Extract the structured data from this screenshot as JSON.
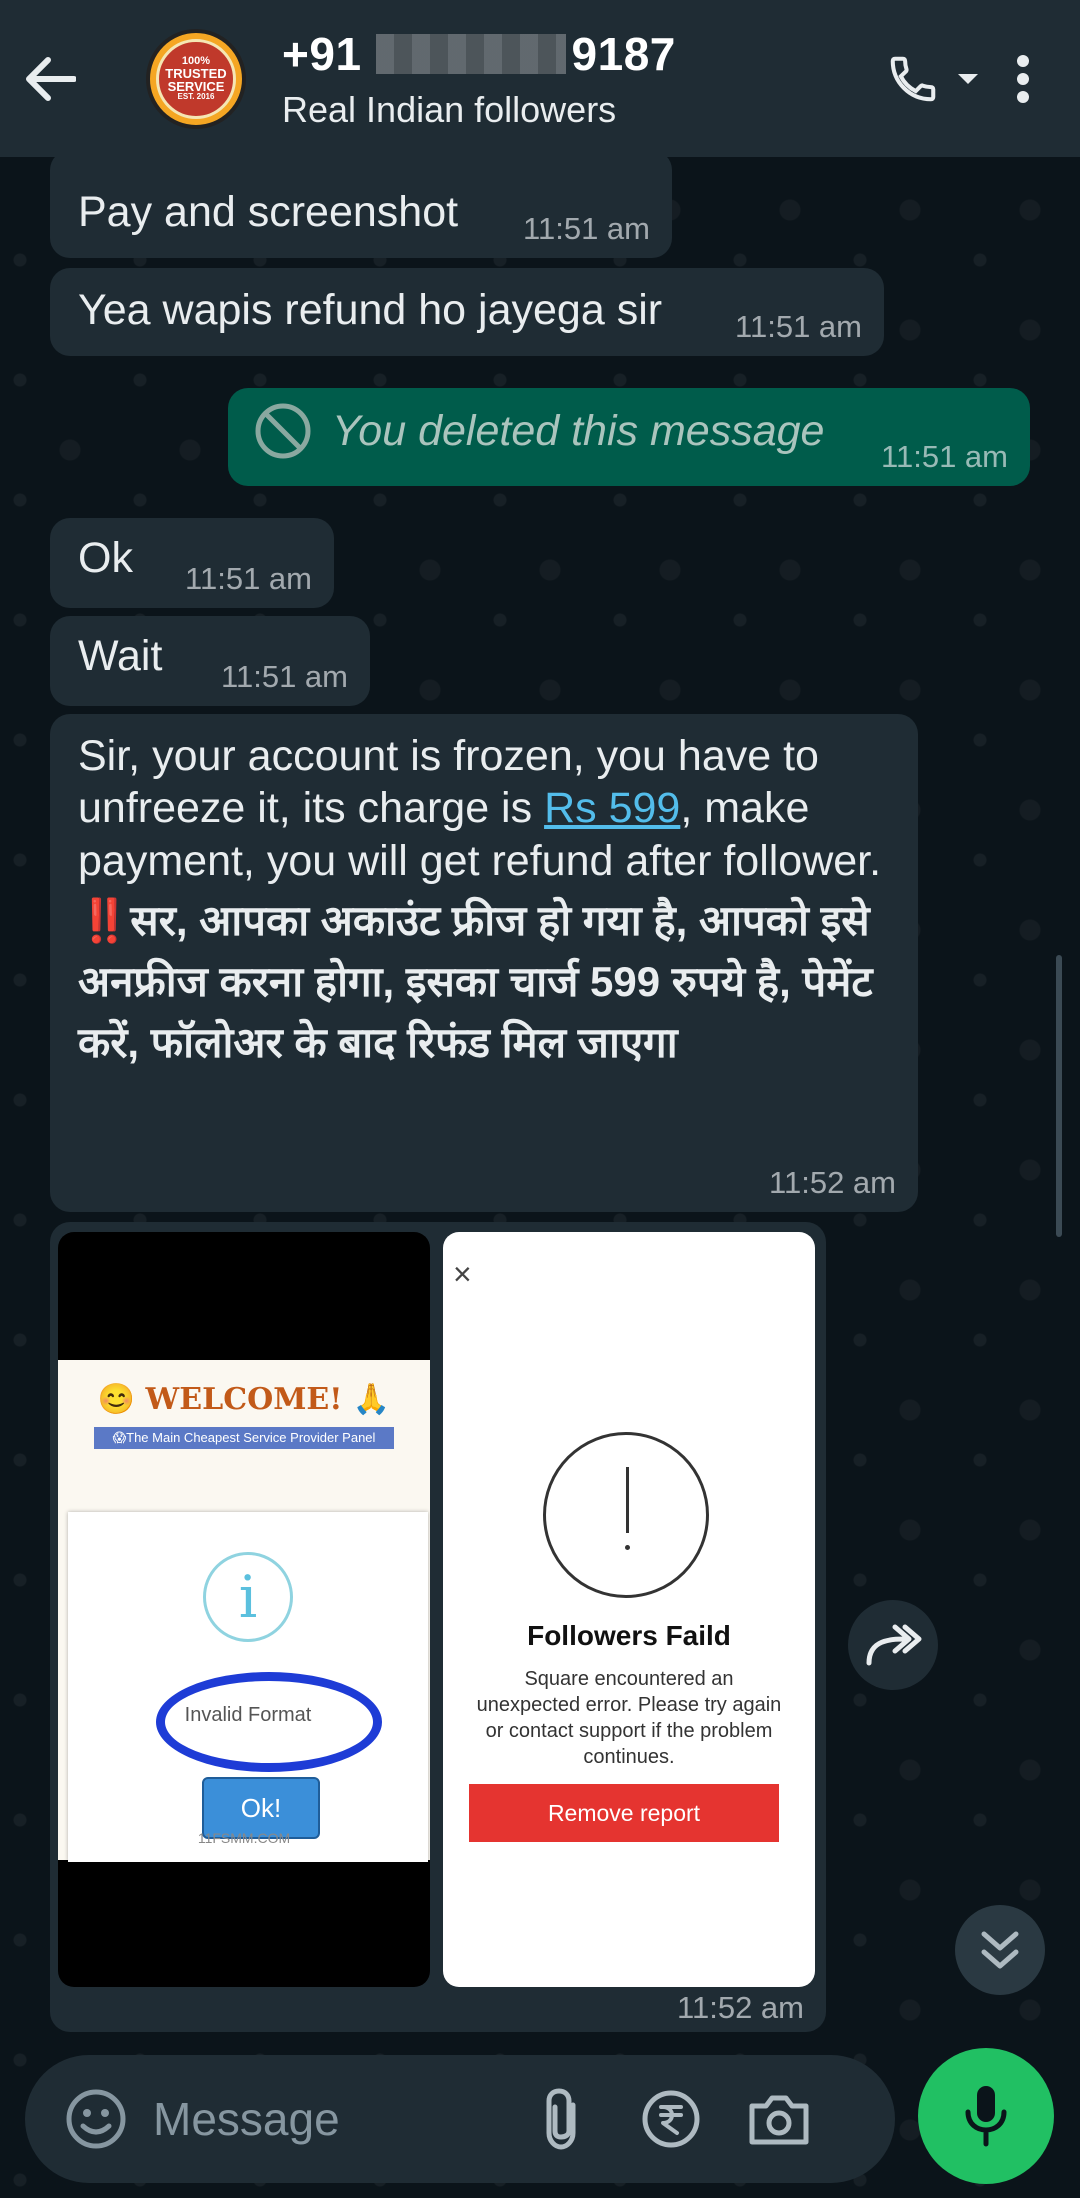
{
  "header": {
    "number_prefix": "+91",
    "number_suffix": "9187",
    "subtitle": "Real Indian followers",
    "avatar_lines": [
      "100%",
      "TRUSTED",
      "SERVICE",
      "EST. 2016"
    ]
  },
  "messages": [
    {
      "text": "Pay and screenshot",
      "time": "11:51 am",
      "direction": "in"
    },
    {
      "text": "Yea wapis refund ho jayega sir",
      "time": "11:51 am",
      "direction": "in"
    },
    {
      "text": "You deleted this message",
      "time": "11:51 am",
      "direction": "out"
    },
    {
      "text": "Ok",
      "time": "11:51 am",
      "direction": "in"
    },
    {
      "text": "Wait",
      "time": "11:51 am",
      "direction": "in"
    },
    {
      "text_before_link": "Sir, your account is frozen, you have to unfreeze it, its charge is ",
      "link": "Rs 599",
      "text_after_link": ", make payment, you will get refund after follower.",
      "bang": "‼️",
      "hindi": "सर, आपका अकाउंट फ्रीज हो गया है, आपको इसे अनफ्रीज करना होगा, इसका चार्ज 599 रुपये है, पेमेंट करें, फॉलोअर के बाद रिफंड मिल जाएगा",
      "time": "11:52 am",
      "direction": "in"
    }
  ],
  "images": {
    "time": "11:52 am",
    "left": {
      "welcome": "😊 WELCOME! 🙏",
      "panel_text": "😱The Main Cheapest Service Provider Panel",
      "dialog_icon": "i",
      "dialog_text": "Invalid Format",
      "ok_label": "Ok!",
      "footer": "11FSMM.COM"
    },
    "right": {
      "close": "×",
      "title": "Followers Faild",
      "body": "Square encountered an unexpected error. Please try again or contact support if the problem continues.",
      "button": "Remove report"
    }
  },
  "input": {
    "placeholder": "Message"
  },
  "colors": {
    "header_bg": "#1f2c34",
    "incoming_bubble": "#1f2c34",
    "outgoing_bubble": "#005c4b",
    "mic_button": "#21c063",
    "link": "#53bdeb"
  },
  "icons": [
    "back-arrow-icon",
    "phone-icon",
    "dropdown-icon",
    "more-vert-icon",
    "deleted-icon",
    "forward-icon",
    "double-chevron-down-icon",
    "emoji-icon",
    "attach-icon",
    "rupee-icon",
    "camera-icon",
    "mic-icon"
  ]
}
